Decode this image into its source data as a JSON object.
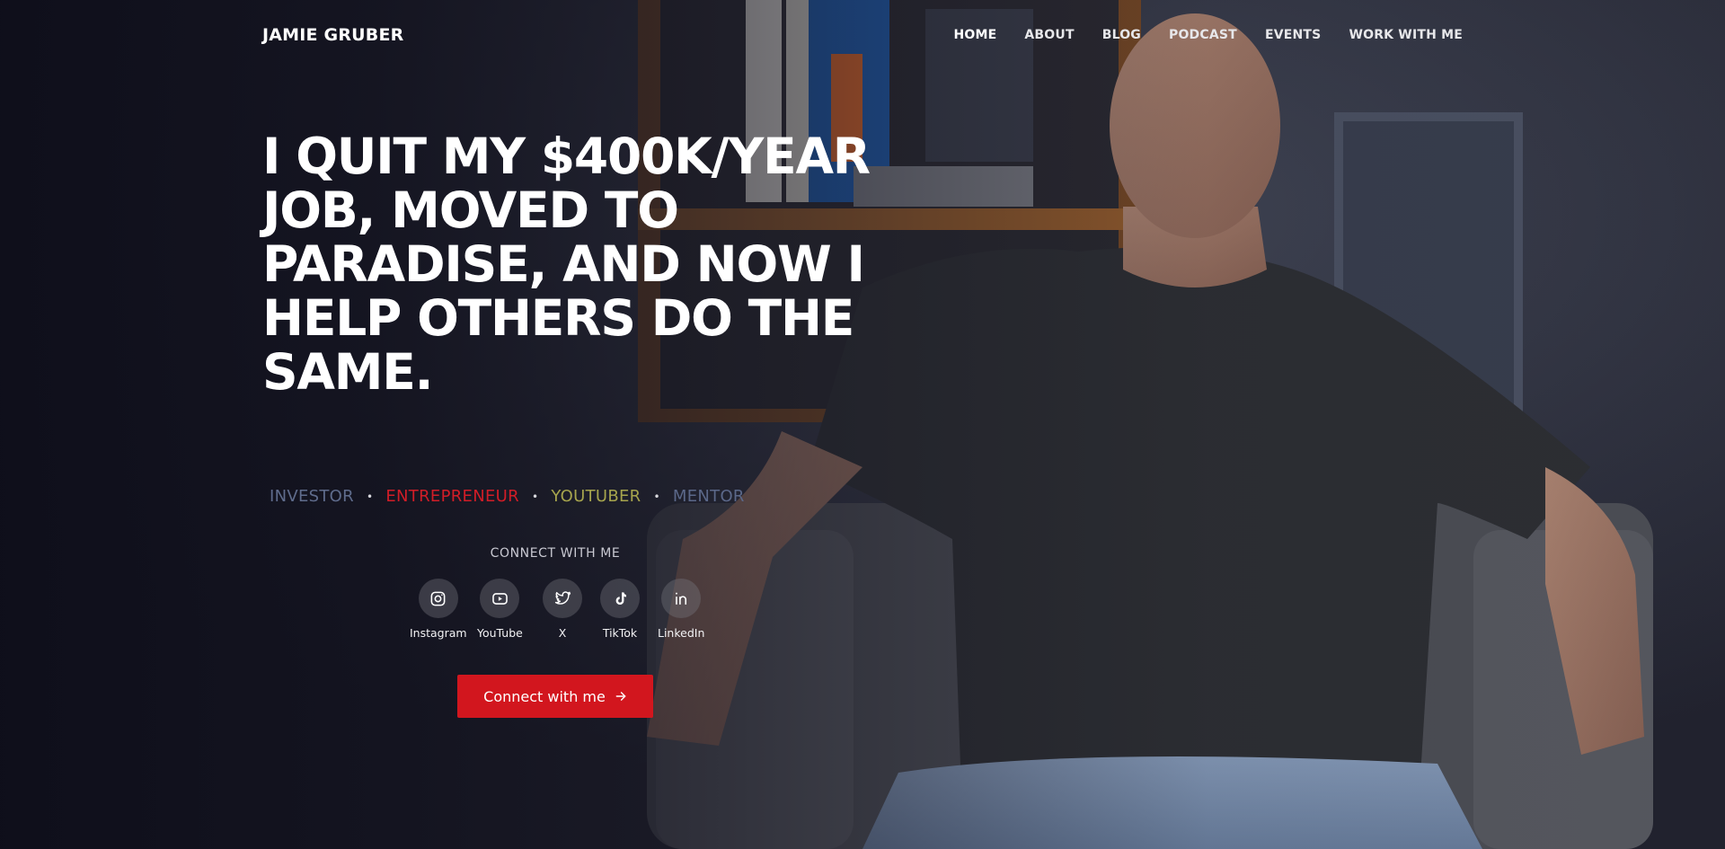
{
  "header": {
    "logo": "JAMIE GRUBER",
    "nav": [
      {
        "label": "HOME"
      },
      {
        "label": "ABOUT"
      },
      {
        "label": "BLOG"
      },
      {
        "label": "PODCAST"
      },
      {
        "label": "EVENTS"
      },
      {
        "label": "WORK WITH ME"
      }
    ]
  },
  "hero": {
    "headline": "I QUIT MY $400K/YEAR JOB, MOVED TO PARADISE, AND NOW I HELP OTHERS DO THE SAME.",
    "roles": [
      {
        "label": "INVESTOR",
        "color": "#5f6c8c"
      },
      {
        "label": "ENTREPRENEUR",
        "color": "#d11d27"
      },
      {
        "label": "YOUTUBER",
        "color": "#a6a44d"
      },
      {
        "label": "MENTOR",
        "color": "#5b6889"
      }
    ],
    "role_separator": "•"
  },
  "connect": {
    "label": "CONNECT WITH ME",
    "socials": [
      {
        "label": "Instagram",
        "icon": "instagram-icon"
      },
      {
        "label": "YouTube",
        "icon": "youtube-icon"
      },
      {
        "label": "X",
        "icon": "x-twitter-icon"
      },
      {
        "label": "TikTok",
        "icon": "tiktok-icon"
      },
      {
        "label": "LinkedIn",
        "icon": "linkedin-icon"
      }
    ],
    "cta_label": "Connect with me",
    "cta_color": "#d2161e"
  },
  "colors": {
    "background": "#141420",
    "text": "#ffffff",
    "accent": "#d2161e"
  }
}
